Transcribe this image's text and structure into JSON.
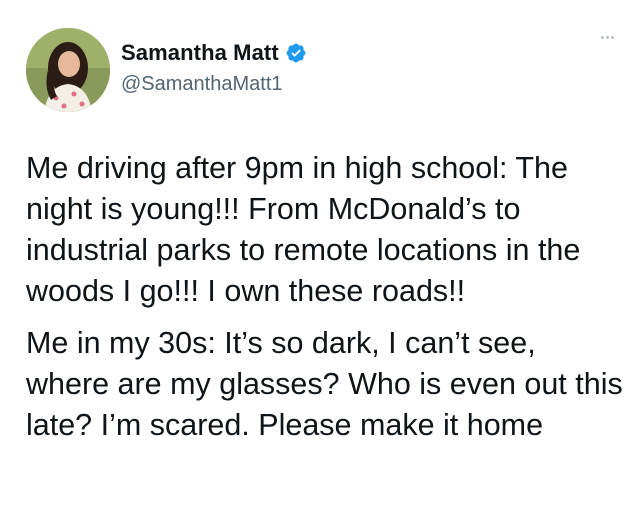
{
  "user": {
    "display_name": "Samantha Matt",
    "handle": "@SamanthaMatt1",
    "verified_icon": "verified-badge-icon",
    "verified_color": "#1d9bf0"
  },
  "menu": {
    "icon": "more-options-icon"
  },
  "tweet": {
    "paragraph_1": "Me driving after 9pm in high school: The night is young!!! From McDonald’s to industrial parks to remote locations in the woods I go!!! I own these roads!!",
    "paragraph_2": "Me in my 30s: It’s so dark, I can’t see, where are my glasses? Who is even out this late? I’m scared. Please make it home"
  }
}
